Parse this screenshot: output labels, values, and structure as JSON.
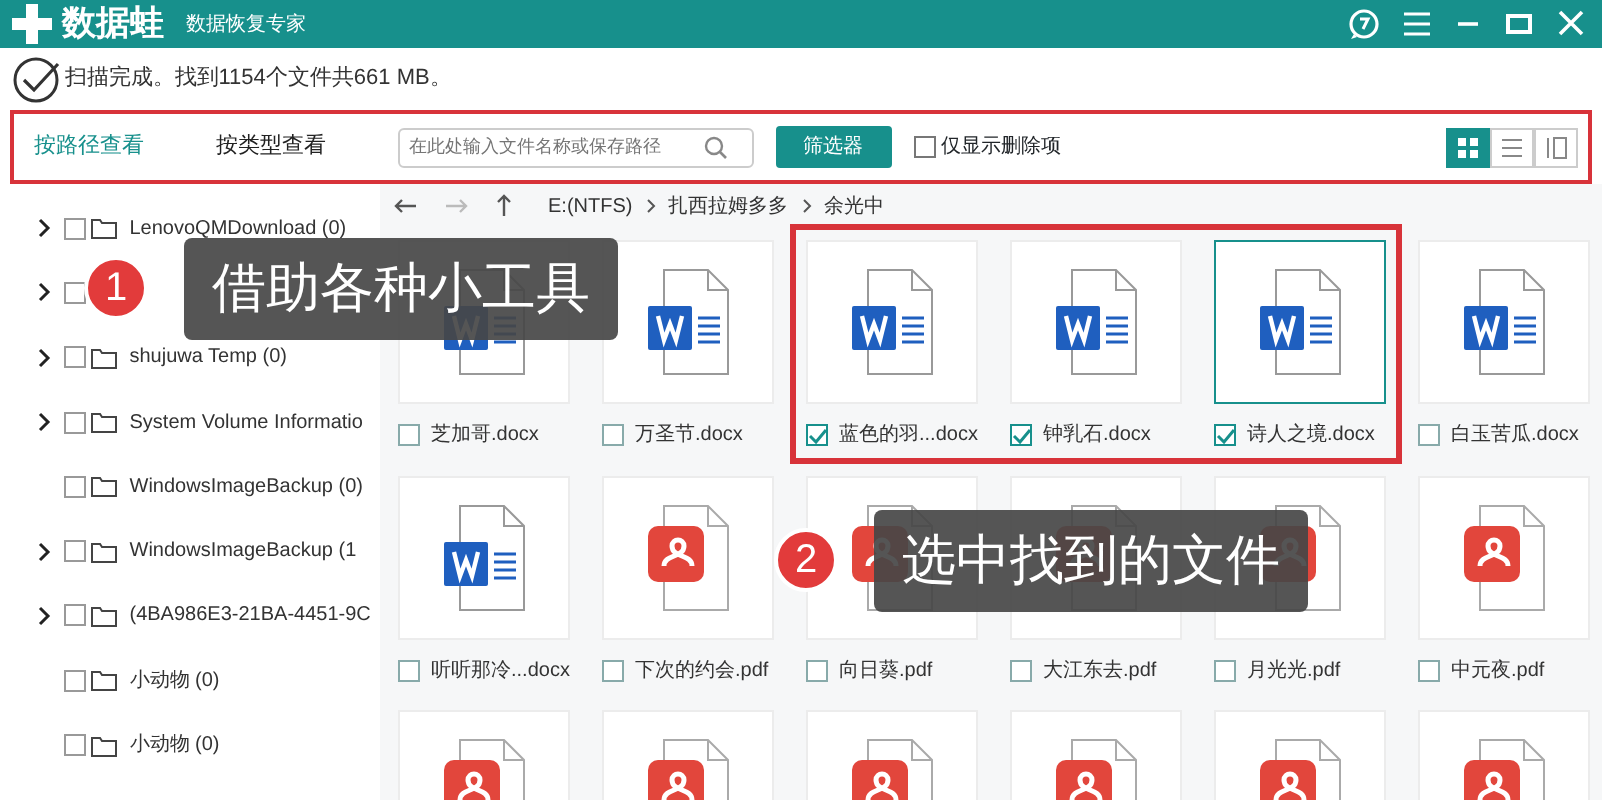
{
  "app": {
    "name": "数据蛙",
    "subtitle": "数据恢复专家"
  },
  "status": {
    "text": "扫描完成。找到1154个文件共661 MB。"
  },
  "toolbar": {
    "highlighted": true,
    "tabs": [
      {
        "label": "按路径查看",
        "selected": true
      },
      {
        "label": "按类型查看",
        "selected": false
      }
    ],
    "search": {
      "placeholder": "在此处输入文件名称或保存路径"
    },
    "filter_button": "筛选器",
    "deleted_only": {
      "label": "仅显示删除项",
      "checked": false
    },
    "views": [
      {
        "kind": "grid",
        "selected": true
      },
      {
        "kind": "list",
        "selected": false
      },
      {
        "kind": "columns",
        "selected": false
      }
    ]
  },
  "sidebar": {
    "items": [
      {
        "label": "LenovoQMDownload (0)",
        "expandable": true,
        "checked": false
      },
      {
        "expandable": true,
        "checked": false
      },
      {
        "label": "shujuwa Temp (0)",
        "expandable": true,
        "checked": false
      },
      {
        "label": "System Volume Informatio",
        "expandable": true,
        "checked": false
      },
      {
        "label": "WindowsImageBackup (0)",
        "expandable": false,
        "checked": false
      },
      {
        "label": "WindowsImageBackup (1",
        "expandable": true,
        "checked": false
      },
      {
        "label": "(4BA986E3-21BA-4451-9C",
        "expandable": true,
        "checked": false
      },
      {
        "label": "小动物 (0)",
        "expandable": false,
        "checked": false
      },
      {
        "label": "小动物 (0)",
        "expandable": false,
        "checked": false
      }
    ]
  },
  "nav": {
    "back_disabled": false,
    "forward_disabled": true,
    "path": [
      "E:(NTFS)",
      "扎西拉姆多多",
      "余光中"
    ]
  },
  "files": [
    {
      "name": "芝加哥.docx",
      "kind": "docx",
      "checked": false,
      "focused": false,
      "framed": false
    },
    {
      "name": "万圣节.docx",
      "kind": "docx",
      "checked": false,
      "focused": false,
      "framed": false
    },
    {
      "name": "蓝色的羽...docx",
      "kind": "docx",
      "checked": true,
      "focused": false,
      "framed": true
    },
    {
      "name": "钟乳石.docx",
      "kind": "docx",
      "checked": true,
      "focused": false,
      "framed": true
    },
    {
      "name": "诗人之境.docx",
      "kind": "docx",
      "checked": true,
      "focused": true,
      "framed": true
    },
    {
      "name": "白玉苦瓜.docx",
      "kind": "docx",
      "checked": false,
      "focused": false,
      "framed": false
    },
    {
      "name": "听听那冷...docx",
      "kind": "docx",
      "checked": false,
      "focused": false,
      "framed": false
    },
    {
      "name": "下次的约会.pdf",
      "kind": "pdf",
      "checked": false,
      "focused": false,
      "framed": false
    },
    {
      "name": "向日葵.pdf",
      "kind": "pdf",
      "checked": false,
      "focused": false,
      "framed": false
    },
    {
      "name": "大江东去.pdf",
      "kind": "pdf",
      "checked": false,
      "focused": false,
      "framed": false
    },
    {
      "name": "月光光.pdf",
      "kind": "pdf",
      "checked": false,
      "focused": false,
      "framed": false
    },
    {
      "name": "中元夜.pdf",
      "kind": "pdf",
      "checked": false,
      "focused": false,
      "framed": false
    },
    {
      "kind": "pdf"
    },
    {
      "kind": "pdf"
    },
    {
      "kind": "pdf"
    },
    {
      "kind": "pdf"
    },
    {
      "kind": "pdf"
    },
    {
      "kind": "pdf"
    }
  ],
  "callouts": [
    {
      "number": "1",
      "text": "借助各种小工具"
    },
    {
      "number": "2",
      "text": "选中找到的文件"
    }
  ]
}
